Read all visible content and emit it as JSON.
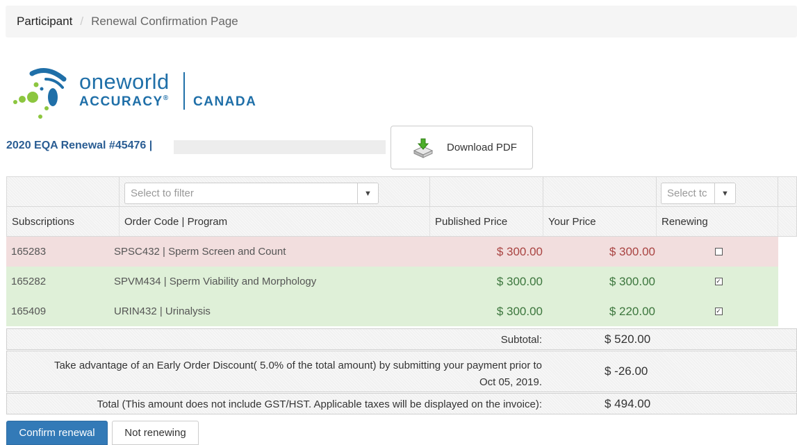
{
  "breadcrumb": {
    "parent": "Participant",
    "separator": "/",
    "current": "Renewal Confirmation Page"
  },
  "logo": {
    "line1": "oneworld",
    "line2": "ACCURACY",
    "registered": "®",
    "region": "CANADA",
    "brand_color": "#1f6fa8",
    "accent_green": "#8cc63f"
  },
  "header": {
    "title": "2020 EQA Renewal #45476 |",
    "download_label": "Download PDF",
    "download_icon": "download-pdf-icon"
  },
  "table": {
    "filters": {
      "program_placeholder": "Select to filter",
      "renewing_placeholder": "Select tc"
    },
    "columns": [
      "Subscriptions",
      "Order Code | Program",
      "Published Price",
      "Your Price",
      "Renewing"
    ],
    "rows": [
      {
        "subscription": "165283",
        "program": "SPSC432 | Sperm Screen and Count",
        "published": "$ 300.00",
        "yours": "$ 300.00",
        "renewing": false,
        "status": "not-renewing"
      },
      {
        "subscription": "165282",
        "program": "SPVM434 | Sperm Viability and Morphology",
        "published": "$ 300.00",
        "yours": "$ 300.00",
        "renewing": true,
        "status": "renewing"
      },
      {
        "subscription": "165409",
        "program": "URIN432 | Urinalysis",
        "published": "$ 300.00",
        "yours": "$ 220.00",
        "renewing": true,
        "status": "renewing"
      }
    ],
    "row_colors": {
      "not-renewing": "#f2dede",
      "renewing": "#dff0d8"
    }
  },
  "summary": {
    "subtotal_label": "Subtotal:",
    "subtotal_value": "$ 520.00",
    "discount_label_line1": "Take advantage of an Early Order Discount( 5.0% of the total amount) by submitting your payment prior to",
    "discount_label_line2": "Oct 05, 2019.",
    "discount_value": "$ -26.00",
    "total_label": "Total (This amount does not include GST/HST. Applicable taxes will be displayed on the invoice):",
    "total_value": "$ 494.00"
  },
  "actions": {
    "confirm_label": "Confirm renewal",
    "decline_label": "Not renewing"
  }
}
